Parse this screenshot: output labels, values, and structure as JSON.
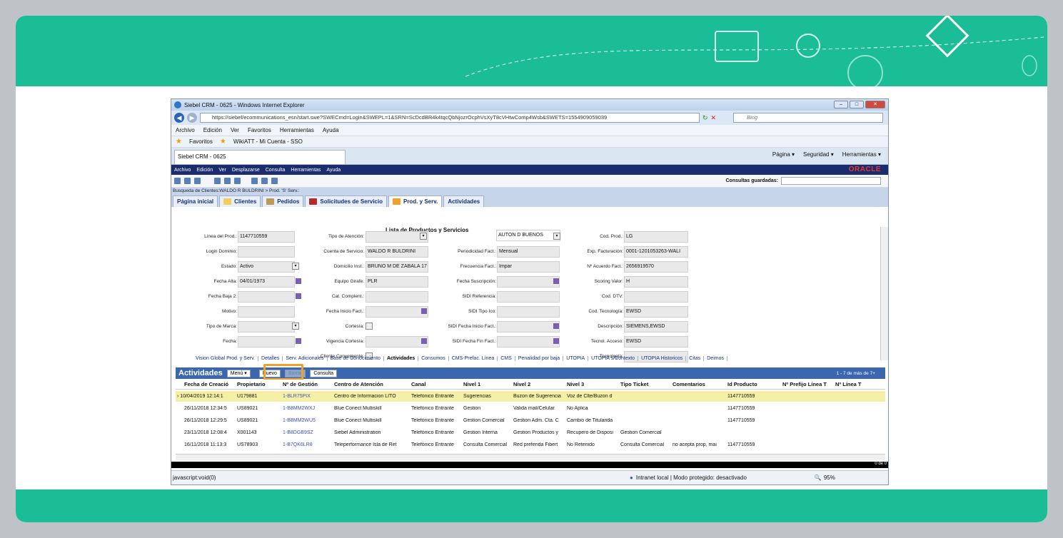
{
  "browser": {
    "window_title": "Siebel CRM - 0625 - Windows Internet Explorer",
    "url": "https://siebel/ecommunications_esn/start.swe?SWECmd=Login&SWEPL=1&SRN=ScDcdBR4k4tqcQbNjozrOcphVsXyT8cVHtwComp4Wsb&SWETS=1554909059039",
    "search_placeholder": "Bing",
    "menu": [
      "Archivo",
      "Edición",
      "Ver",
      "Favoritos",
      "Herramientas",
      "Ayuda"
    ],
    "favorites_label": "Favoritos",
    "favorite_item": "WikiATT - Mi Cuenta - SSO",
    "tab_title": "Siebel CRM - 0625",
    "commands": [
      "Página ▾",
      "Seguridad ▾",
      "Herramientas ▾"
    ]
  },
  "siebel": {
    "menu": [
      "Archivo",
      "Edición",
      "Ver",
      "Desplazarse",
      "Consulta",
      "Herramientas",
      "Ayuda"
    ],
    "brand": "ORACLE",
    "saved_queries_label": "Consultas guardadas:",
    "breadcrumb": "Busqueda de Clientes:WALDO R BULDRINI  > Prod. 'S' Serv.:",
    "tabs": [
      "Página inicial",
      "Clientes",
      "Pedidos",
      "Solicitudes de Servicio",
      "Prod. y Serv.",
      "Actividades"
    ],
    "form_title": "Lista de Productos y Servicios",
    "form": {
      "linea_prod_label": "Línea del Prod.:",
      "linea_prod": "1147710559",
      "login_label": "Login Dominio:",
      "estado_label": "Estado:",
      "estado": "Activo",
      "fecha_alta_label": "Fecha Alta:",
      "fecha_alta": "04/01/1973",
      "fecha_baja_label": "Fecha Baja 2:",
      "motivo_label": "Motivo:",
      "tipo_marca_label": "Tipo de Marca:",
      "fecha_label": "Fecha:",
      "tipo_atencion_label": "Tipo de Atención:",
      "cuenta_label": "Cuenta de Servicio:",
      "cuenta": "WALDO R BULDRINI",
      "domicilio_label": "Domicilio Inst.:",
      "domicilio": "BRUNO M DE ZABALA 17",
      "equipo_label": "Equipo Girafe:",
      "equipo": "PLR",
      "cat_label": "Cat. Complent.:",
      "fecha_inicio_label": "Fecha Inicio Fact.:",
      "cortesia_label": "Cortesía:",
      "vigencia_label": "Vigencia Cortesía:",
      "cliente_conv_label": "Cliente Convergente:",
      "auton": "AUTON D BUENOS",
      "periodicidad_label": "Periodicidad Fact.:",
      "periodicidad": "Mensual",
      "frecuencia_label": "Frecuencia Fact.:",
      "frecuencia": "Impar",
      "fecha_susc_label": "Fecha Suscripción:",
      "sidi_ref_label": "SIDI Referencia:",
      "sidi_tipo_label": "SIDI Tipo Ico:",
      "sidi_inicio_label": "SIDI Fecha Inicio Fact.:",
      "sidi_fin_label": "SIDI Fecha Fin Fact.:",
      "cod_prod_label": "Cod. Prod.:",
      "cod_prod": "LG",
      "exp_fact_label": "Exp. Facturación:",
      "exp_fact": "0001-1201053263-WALI",
      "acuerdo_label": "Nº Acuerdo Fact.:",
      "acuerdo": "2656919570",
      "scoring_label": "Scoring Valor:",
      "scoring": "H",
      "cod_dtv_label": "Cod. DTV:",
      "cod_tec_label": "Cod. Tecnología:",
      "cod_tec": "EWSD",
      "descripcion_label": "Descripción:",
      "descripcion": "SIEMENS,EWSD",
      "tecnol_label": "Tecnol. Acceso:",
      "tecnol": "EWSD",
      "tecnologia_label": "Tecnología:"
    },
    "subtabs": [
      "Vision Global Prod. y Serv.",
      "Detalles",
      "Serv. Adicionales",
      "Base de Conocimiento",
      "Actividades",
      "Consumos",
      "CMS-Prefac. Línea",
      "CMS",
      "Penalidad por baja",
      "UTOPIA",
      "UTOPIA s/Contexto",
      "UTOPIA Historicos",
      "Citas",
      "Deimos"
    ],
    "list": {
      "title": "Actividades",
      "menu_btn": "Menú ▾",
      "new_btn": "Nuevo",
      "delete_btn": "Borrar",
      "query_btn": "Consulta",
      "count": "1 - 7 de más de 7+",
      "columns": [
        "Fecha de Creació",
        "Propietario",
        "Nº de Gestión",
        "Centro de Atención",
        "Canal",
        "Nivel 1",
        "Nivel 2",
        "Nivel 3",
        "Tipo Ticket",
        "Comentarios",
        "Id Producto",
        "Nº Prefijo Línea T",
        "Nº Línea T"
      ],
      "rows": [
        [
          "10/04/2019 12:14:1",
          "U179881",
          "1-BLR75PIX",
          "Centro de Informacion LITO",
          "Telefónico Entrante",
          "Sugerencias",
          "Buzon de Sugerencia",
          "Voz de Clte/Buzon d",
          "",
          "",
          "1147710559"
        ],
        [
          "26/11/2018 12:34:5",
          "US89021",
          "1-B8MM2WXJ",
          "Blue Conect Multiskill",
          "Telefónico Entrante",
          "Gestion",
          "Valida mail/Celular",
          "No Aplica",
          "",
          "",
          "1147710559"
        ],
        [
          "26/11/2018 12:29:5",
          "US89021",
          "1-B8MM2WU5",
          "Blue Conect Multiskill",
          "Telefónico Entrante",
          "Gestion Comercial",
          "Gestion Adm. Cta. C",
          "Cambio de Titularida",
          "",
          "",
          "1147710559"
        ],
        [
          "23/11/2018 12:08:4",
          "X001143",
          "1-B8DGB9SZ",
          "Siebel Administration",
          "Telefónico Entrante",
          "Gestion Interna",
          "Gestion Productos y",
          "Recupero de Disposi",
          "Gestion Comercial",
          "",
          ""
        ],
        [
          "16/11/2018 11:13:3",
          "US78903",
          "1-B7QK6LR8",
          "Teleperformance Isla de Ret",
          "Telefónico Entrante",
          "Consulta Comercial",
          "Red preferida Fibert",
          "No Retenido",
          "Consulta Comercial",
          "no acepta prop, mai",
          "1147710559"
        ]
      ]
    }
  },
  "statusbar": {
    "left": "javascript:void(0)",
    "zone": "Intranet local | Modo protegido: desactivado",
    "zoom": "95%",
    "page_count": "0 de 0"
  },
  "colors": {
    "teal": "#1bbd97",
    "siebel_navy": "#1b2c6e",
    "highlight": "#f0a12a",
    "selected_row": "#f5f0a6"
  }
}
